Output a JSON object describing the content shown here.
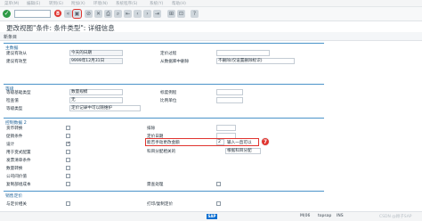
{
  "menubar": {
    "items": [
      "菜单(M)",
      "编辑(E)",
      "转到(G)",
      "附加(X)",
      "环境(N)",
      "系统程序(S)",
      "系统(Y)",
      "帮助(H)"
    ]
  },
  "toolbar": {
    "enter_icon": "check-icon",
    "command_value": "",
    "step_badge_8": "8"
  },
  "header": {
    "title": "更改视图\"条件: 条件类型\": 详细信息"
  },
  "appbar": {
    "new_entries": "新条目"
  },
  "sections": {
    "master": {
      "title": "主数据",
      "fields": {
        "ref_step_label": "建议有效从",
        "ref_step_value": "今天的日期",
        "ref_cond_label": "建议有效至",
        "ref_cond_value": "9999年12月31日",
        "access_seq_label": "定价过程",
        "access_seq_value": "",
        "delete_label": "从数据库中删除",
        "delete_value": "不删除(仅设置删除标识)"
      }
    },
    "scales": {
      "title": "等级",
      "fields": {
        "scale_base_label": "等级基础类型",
        "scale_base_value": "数量规模",
        "check_value_label": "检查值",
        "check_value_value": "无",
        "scale_type_label": "等级类型",
        "scale_type_value": "定价记录中可以随维护",
        "scale_formula_label": "标度例程",
        "unit_label": "比例单位"
      }
    },
    "control": {
      "title": "控制数据 2",
      "left": [
        "货币转换",
        "促销条件",
        "设计",
        "用于变式配置",
        "发票清单条件",
        "数量转换",
        "公司间价值",
        "复制部组成本"
      ],
      "left_checked": [
        false,
        false,
        true,
        false,
        false,
        false,
        false,
        false
      ],
      "right": {
        "exclusion_label": "排除",
        "pricing_date_label": "定价日期",
        "changes_label": "能否手动更改金额",
        "changes_code": "2",
        "changes_text": "输入一直可以",
        "quantity_label": "科目分配相关的",
        "quantity_value": "根据科目分配",
        "statistical_label": "需查处理"
      },
      "step_badge_7": "7"
    },
    "text": {
      "title": "销售定价",
      "print_label": "与定价相关",
      "pricing_label": "打印/复制定价"
    }
  },
  "statusbar": {
    "sap_logo": "SAP",
    "session": "M(06",
    "host": "topsap",
    "mode": "INS",
    "watermark": "CSDN @顾子SAP"
  }
}
